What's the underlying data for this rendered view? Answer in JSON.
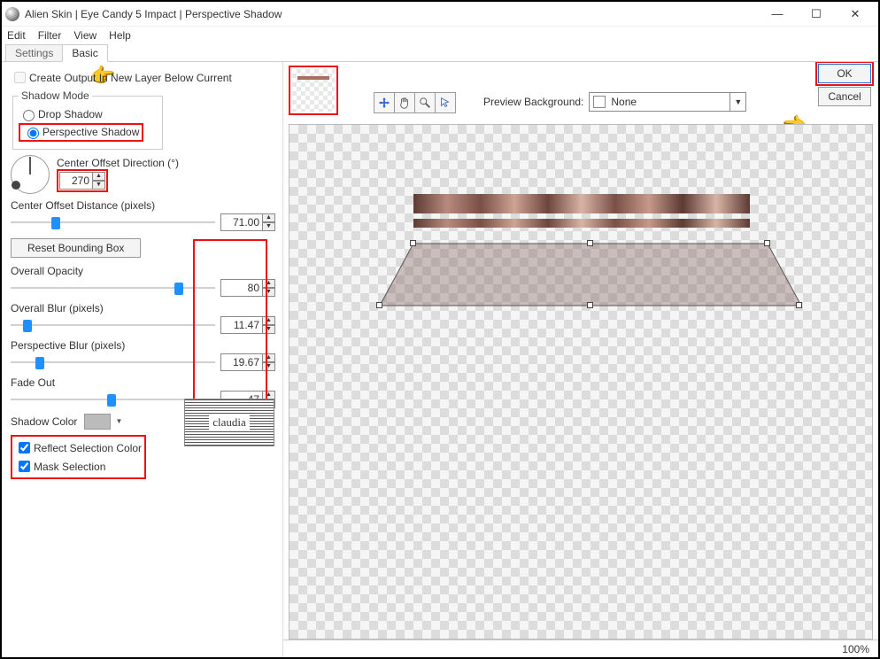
{
  "title": "Alien Skin | Eye Candy 5 Impact | Perspective Shadow",
  "menu": {
    "edit": "Edit",
    "filter": "Filter",
    "view": "View",
    "help": "Help"
  },
  "tabs": {
    "settings": "Settings",
    "basic": "Basic"
  },
  "left": {
    "createOutput": "Create Output In New Layer Below Current",
    "shadowModeLegend": "Shadow Mode",
    "dropShadow": "Drop Shadow",
    "perspectiveShadow": "Perspective Shadow",
    "centerOffsetDir": "Center Offset Direction (°)",
    "centerOffsetDirVal": "270",
    "centerOffsetDist": "Center Offset Distance (pixels)",
    "centerOffsetDistVal": "71.00",
    "resetBox": "Reset Bounding Box",
    "overallOpacity": "Overall Opacity",
    "overallOpacityVal": "80",
    "overallBlur": "Overall Blur (pixels)",
    "overallBlurVal": "11.47",
    "perspectiveBlur": "Perspective Blur (pixels)",
    "perspectiveBlurVal": "19.67",
    "fadeOut": "Fade Out",
    "fadeOutVal": "47",
    "shadowColor": "Shadow Color",
    "reflectSel": "Reflect Selection Color",
    "maskSel": "Mask Selection"
  },
  "right": {
    "previewBg": "Preview Background:",
    "previewBgVal": "None",
    "ok": "OK",
    "cancel": "Cancel"
  },
  "status": {
    "zoom": "100%"
  },
  "watermark": "claudia"
}
